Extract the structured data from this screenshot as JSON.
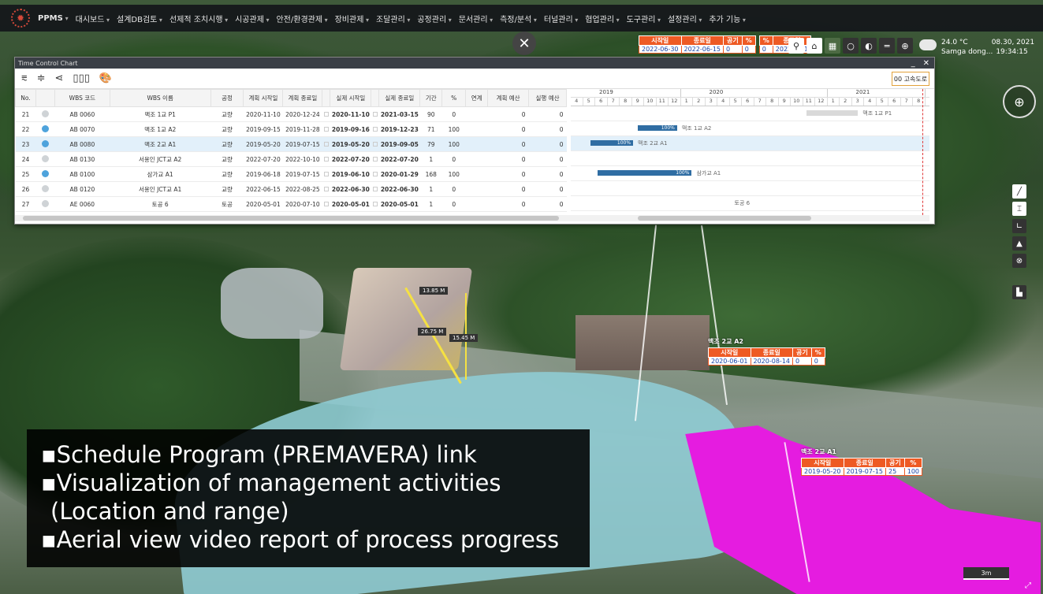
{
  "nav": {
    "brand": "PPMS",
    "menu": [
      "대시보드",
      "설계DB검토",
      "선제적 조치시행",
      "시공관제",
      "안전/환경관제",
      "장비관제",
      "조달관리",
      "공정관리",
      "문서관리",
      "측정/분석",
      "터널관리",
      "협업관리",
      "도구관리",
      "설정관리",
      "추가 기능"
    ]
  },
  "top_schedule": {
    "table1": {
      "headers": [
        "시작일",
        "종료일",
        "공기",
        "%"
      ],
      "values": [
        "2022-06-30",
        "2022-06-15",
        "0",
        "0"
      ]
    },
    "table2": {
      "headers": [
        "%",
        "종료일"
      ],
      "values": [
        "0",
        "2022-08-1"
      ]
    }
  },
  "weather": {
    "temp": "24.0 °C",
    "location": "Samga dong...",
    "date": "08.30, 2021",
    "time": "19:34:15"
  },
  "tcc": {
    "title": "Time Control Chart",
    "search_label": "00 고속도로",
    "columns": [
      "No.",
      "",
      "WBS 코드",
      "WBS 이름",
      "공정",
      "계획 시작일",
      "계획 종료일",
      "",
      "실제 시작일",
      "",
      "실제 종료일",
      "기간",
      "%",
      "연계",
      "계획 예산",
      "실행 예산"
    ],
    "rows": [
      {
        "no": "21",
        "code": "AB 0060",
        "name": "맥조 1교 P1",
        "proc": "교량",
        "ps": "2020-11-10",
        "pe": "2020-12-24",
        "as": "2020-11-10",
        "ae": "2021-03-15",
        "dur": "90",
        "pct": "0",
        "link": "",
        "pb": "0",
        "eb": "0",
        "status": "gray"
      },
      {
        "no": "22",
        "code": "AB 0070",
        "name": "맥조 1교 A2",
        "proc": "교량",
        "ps": "2019-09-15",
        "pe": "2019-11-28",
        "as": "2019-09-16",
        "ae": "2019-12-23",
        "dur": "71",
        "pct": "100",
        "link": "",
        "pb": "0",
        "eb": "0",
        "status": "blue"
      },
      {
        "no": "23",
        "code": "AB 0080",
        "name": "맥조 2교 A1",
        "proc": "교량",
        "ps": "2019-05-20",
        "pe": "2019-07-15",
        "as": "2019-05-20",
        "ae": "2019-09-05",
        "dur": "79",
        "pct": "100",
        "link": "",
        "pb": "0",
        "eb": "0",
        "status": "blue"
      },
      {
        "no": "24",
        "code": "AB 0130",
        "name": "서용인 JCT교 A2",
        "proc": "교량",
        "ps": "2022-07-20",
        "pe": "2022-10-10",
        "as": "2022-07-20",
        "ae": "2022-07-20",
        "dur": "1",
        "pct": "0",
        "link": "",
        "pb": "0",
        "eb": "0",
        "status": "gray"
      },
      {
        "no": "25",
        "code": "AB 0100",
        "name": "삼가교 A1",
        "proc": "교량",
        "ps": "2019-06-18",
        "pe": "2019-07-15",
        "as": "2019-06-10",
        "ae": "2020-01-29",
        "dur": "168",
        "pct": "100",
        "link": "",
        "pb": "0",
        "eb": "0",
        "status": "blue"
      },
      {
        "no": "26",
        "code": "AB 0120",
        "name": "서용인 JCT교 A1",
        "proc": "교량",
        "ps": "2022-06-15",
        "pe": "2022-08-25",
        "as": "2022-06-30",
        "ae": "2022-06-30",
        "dur": "1",
        "pct": "0",
        "link": "",
        "pb": "0",
        "eb": "0",
        "status": "gray"
      },
      {
        "no": "27",
        "code": "AE 0060",
        "name": "토공 6",
        "proc": "토공",
        "ps": "2020-05-01",
        "pe": "2020-07-10",
        "as": "2020-05-01",
        "ae": "2020-05-01",
        "dur": "1",
        "pct": "0",
        "link": "",
        "pb": "0",
        "eb": "0",
        "status": "gray"
      }
    ],
    "gantt": {
      "years": [
        "2019",
        "2020",
        "2021"
      ],
      "months": [
        "4",
        "5",
        "6",
        "7",
        "8",
        "9",
        "10",
        "11",
        "12",
        "1",
        "2",
        "3",
        "4",
        "5",
        "6",
        "7",
        "8",
        "9",
        "10",
        "11",
        "12",
        "1",
        "2",
        "3",
        "4",
        "5",
        "6",
        "7",
        "8"
      ],
      "bars": [
        {
          "label": "맥조 1교 P1",
          "pct": "",
          "start_month": 19.3,
          "end_month": 23.5,
          "done": false
        },
        {
          "label": "맥조 1교 A2",
          "pct": "100%",
          "start_month": 5.5,
          "end_month": 8.7,
          "done": true
        },
        {
          "label": "맥조 2교 A1",
          "pct": "100%",
          "start_month": 1.6,
          "end_month": 5.1,
          "done": true
        },
        {
          "label": "",
          "pct": "",
          "start_month": null,
          "end_month": null,
          "done": false
        },
        {
          "label": "삼가교 A1",
          "pct": "100%",
          "start_month": 2.2,
          "end_month": 9.9,
          "done": true
        },
        {
          "label": "",
          "pct": "",
          "start_month": null,
          "end_month": null,
          "done": false
        },
        {
          "label": "토공 6",
          "pct": "",
          "start_month": 13.0,
          "end_month": 13.0,
          "done": false
        }
      ]
    }
  },
  "measurements": [
    "13.85 M",
    "26.75 M",
    "15.45 M"
  ],
  "callouts": [
    {
      "title": "맥조 2교 A2",
      "headers": [
        "시작일",
        "종료일",
        "공기",
        "%"
      ],
      "values": [
        "2020-06-01",
        "2020-08-14",
        "0",
        "0"
      ]
    },
    {
      "title": "맥조 2교 A1",
      "headers": [
        "시작일",
        "종료일",
        "공기",
        "%"
      ],
      "values": [
        "2019-05-20",
        "2019-07-15",
        "25",
        "100"
      ]
    }
  ],
  "caption": {
    "lines": [
      "▪Schedule Program (PREMAVERA) link",
      "▪Visualization of management activities",
      "(Location and range)",
      "▪Aerial view video report of process progress"
    ]
  },
  "scale": "3m",
  "colors": {
    "accent": "#ee5a24",
    "bar": "#2f6da3",
    "selection": "#e2f0fa",
    "magenta": "#e51ce0",
    "cyan": "#8fcbd3"
  }
}
